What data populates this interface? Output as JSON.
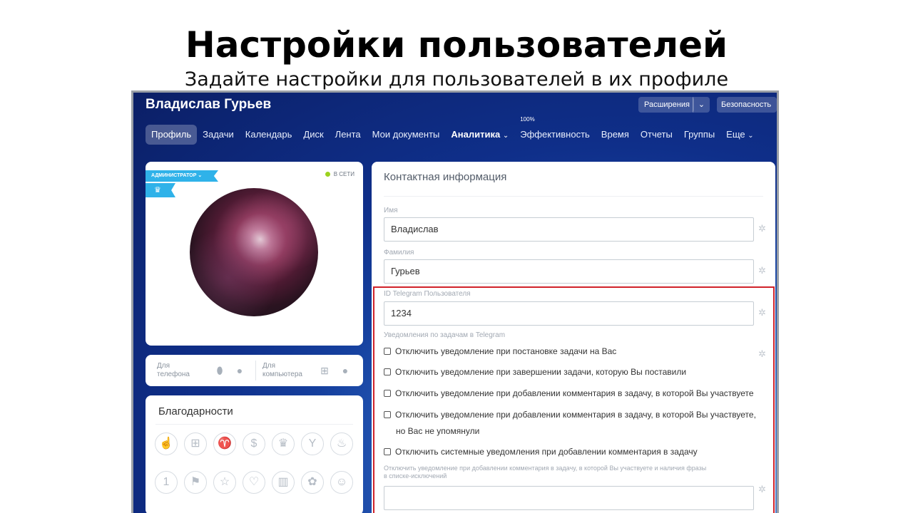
{
  "slide": {
    "title": "Настройки пользователей",
    "subtitle": "Задайте настройки для пользователей в их профиле"
  },
  "header": {
    "user_name": "Владислав Гурьев",
    "extensions_label": "Расширения",
    "security_label": "Безопасность"
  },
  "nav": {
    "items": [
      {
        "label": "Профиль"
      },
      {
        "label": "Задачи"
      },
      {
        "label": "Календарь"
      },
      {
        "label": "Диск"
      },
      {
        "label": "Лента"
      },
      {
        "label": "Мои документы"
      },
      {
        "label": "Аналитика"
      },
      {
        "label": "Эффективность",
        "badge": "100%"
      },
      {
        "label": "Время"
      },
      {
        "label": "Отчеты"
      },
      {
        "label": "Группы"
      },
      {
        "label": "Еще"
      }
    ]
  },
  "profile": {
    "role": "АДМИНИСТРАТОР",
    "status": "В СЕТИ"
  },
  "apps": {
    "phone_label": "Для телефона",
    "computer_label": "Для компьютера"
  },
  "thanks": {
    "title": "Благодарности",
    "icons": [
      "thumbs-up",
      "gift",
      "trophy",
      "money",
      "crown",
      "cocktail",
      "cake",
      "number-one",
      "flag",
      "star",
      "heart",
      "beer",
      "flower",
      "smile"
    ]
  },
  "contact": {
    "title": "Контактная информация",
    "first_name_label": "Имя",
    "first_name_value": "Владислав",
    "last_name_label": "Фамилия",
    "last_name_value": "Гурьев",
    "telegram_label": "ID Telegram Пользователя",
    "telegram_value": "1234",
    "notifications_label": "Уведомления по задачам в Telegram",
    "checkboxes": [
      {
        "label": "Отключить уведомление при постановке задачи на Вас",
        "checked": false
      },
      {
        "label": "Отключить уведомление при завершении задачи, которую Вы поставили",
        "checked": false
      },
      {
        "label": "Отключить уведомление при добавлении комментария в задачу, в которой Вы участвуете",
        "checked": false
      },
      {
        "label": "Отключить уведомление при добавлении комментария в задачу, в которой Вы участвуете,",
        "label_line2": "но Вас не упомянули",
        "checked": false
      },
      {
        "label": "Отключить системные уведомления при добавлении комментария в задачу",
        "checked": false
      }
    ],
    "exceptions_label_line1": "Отключить уведомление при добавлении комментария в задачу, в которой Вы участвуете и наличия фразы",
    "exceptions_label_line2": "в списке-исключений",
    "exceptions_value": ""
  },
  "colors": {
    "highlight": "#d0222a",
    "ribbon": "#2fb2e9",
    "online": "#9cd21e"
  }
}
